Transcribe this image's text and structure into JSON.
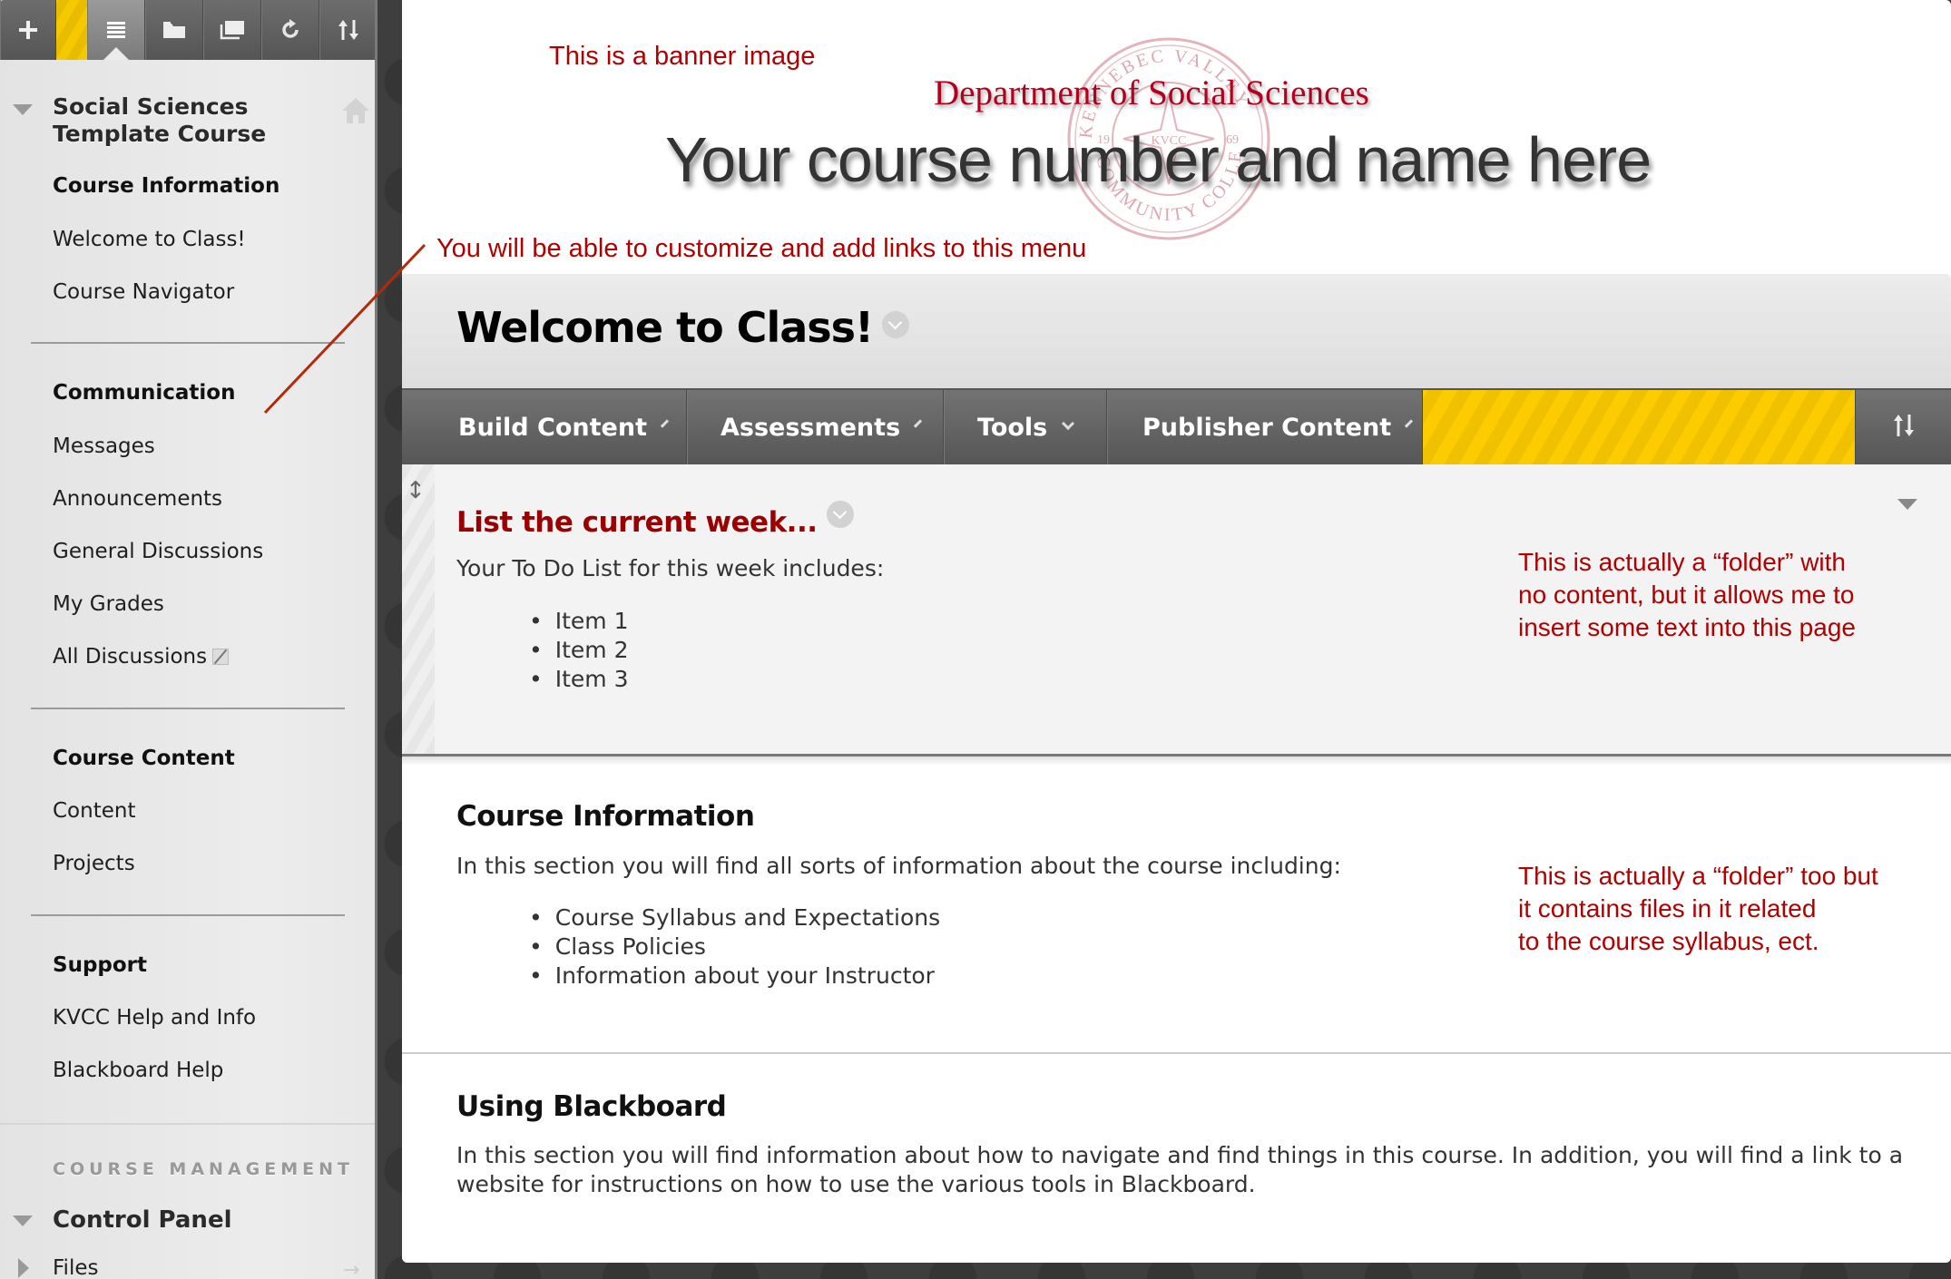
{
  "sidebar": {
    "toolbar": {
      "buttons": [
        {
          "name": "add-menu-item",
          "icon": "plus-icon"
        },
        {
          "name": "course-menu",
          "icon": "list-icon"
        },
        {
          "name": "folder-view",
          "icon": "folder-icon"
        },
        {
          "name": "open-new-window",
          "icon": "windows-icon"
        },
        {
          "name": "refresh",
          "icon": "refresh-icon"
        },
        {
          "name": "reorder",
          "icon": "sort-arrows-icon"
        }
      ]
    },
    "course_title": "Social Sciences Template Course",
    "menu": [
      {
        "label": "Course Information",
        "type": "header"
      },
      {
        "label": "Welcome to Class!",
        "type": "link"
      },
      {
        "label": "Course Navigator",
        "type": "link"
      },
      {
        "label": "Communication",
        "type": "header"
      },
      {
        "label": "Messages",
        "type": "link"
      },
      {
        "label": "Announcements",
        "type": "link"
      },
      {
        "label": "General Discussions",
        "type": "link"
      },
      {
        "label": "My Grades",
        "type": "link"
      },
      {
        "label": "All Discussions",
        "type": "link",
        "hidden_from_students": true
      },
      {
        "label": "Course Content",
        "type": "header"
      },
      {
        "label": "Content",
        "type": "link"
      },
      {
        "label": "Projects",
        "type": "link"
      },
      {
        "label": "Support",
        "type": "header"
      },
      {
        "label": "KVCC Help and Info",
        "type": "link"
      },
      {
        "label": "Blackboard Help",
        "type": "link"
      }
    ],
    "management": {
      "label": "COURSE MANAGEMENT",
      "control_panel": "Control Panel",
      "files": "Files"
    }
  },
  "banner": {
    "annotation": "This is a banner image",
    "department": "Department of Social Sciences",
    "course_placeholder": "Your course number and name here",
    "seal": {
      "top": "KENNEBEC VALLEY",
      "bottom": "COMMUNITY COLLEGE",
      "center": "KVCC",
      "year_left": "19",
      "year_right": "69"
    },
    "menu_annotation": "You will be able to customize and add links to this menu"
  },
  "page": {
    "title": "Welcome to Class!"
  },
  "action_bar": {
    "buttons": [
      "Build Content",
      "Assessments",
      "Tools",
      "Publisher Content"
    ]
  },
  "items": [
    {
      "title": "List the current week...",
      "text": "Your To Do List for this week includes:",
      "list": [
        "Item 1",
        "Item 2",
        "Item 3"
      ],
      "annotation": "This is actually a “folder” with\nno content, but it allows me to\ninsert some text into this page"
    },
    {
      "title": "Course Information",
      "text": "In this section you will find all sorts of information about the course including:",
      "list": [
        "Course Syllabus and Expectations",
        "Class Policies",
        "Information about your Instructor"
      ],
      "annotation": "This is actually a “folder” too but\nit contains files in it related\nto the course syllabus, ect."
    },
    {
      "title": "Using Blackboard",
      "text": "In this section you will find information about how to navigate and find things in this course.  In addition, you will find a link to a website for instructions on how to use the various tools in Blackboard."
    }
  ],
  "colors": {
    "accent_yellow": "#fccc00",
    "annotation_red": "#b00000",
    "item_title_red": "#990000",
    "action_bar": "#616161"
  }
}
